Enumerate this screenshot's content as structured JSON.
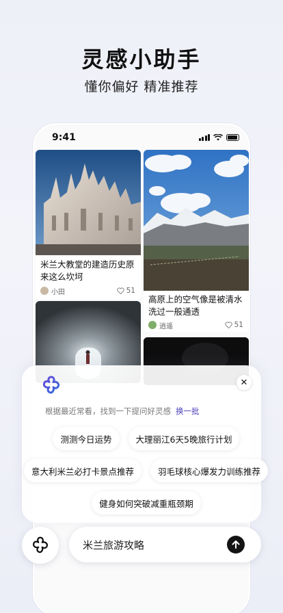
{
  "hero": {
    "title": "灵感小助手",
    "subtitle": "懂你偏好 精准推荐"
  },
  "status_bar": {
    "time": "9:41"
  },
  "feed": [
    {
      "title": "米兰大教堂的建造历史原来这么坎坷",
      "author": "小田",
      "likes": "51"
    },
    {
      "title": "高原上的空气像是被清水洗过一般通透",
      "author": "逍遥",
      "likes": "51"
    }
  ],
  "assistant": {
    "hint": "根据最近常看，找到一下提问好灵感",
    "refresh_label": "换一批",
    "suggestions": [
      "测测今日运势",
      "大理丽江6天5晚旅行计划",
      "意大利米兰必打卡景点推荐",
      "羽毛球核心爆发力训练推荐",
      "健身如何突破减重瓶颈期"
    ]
  },
  "input": {
    "value": "米兰旅游攻略"
  },
  "icons": {
    "logo": "flower-logo-icon",
    "close": "close-icon",
    "send": "send-arrow-icon",
    "like": "heart-icon"
  },
  "colors": {
    "accent": "#4a3fb8",
    "send_button": "#141414"
  }
}
